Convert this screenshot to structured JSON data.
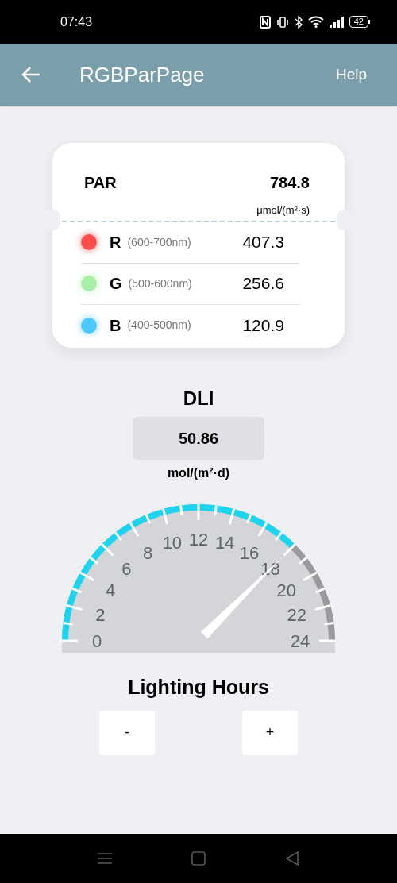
{
  "status_bar": {
    "time": "07:43",
    "battery": "42"
  },
  "app_bar": {
    "title": "RGBParPage",
    "action": "Help"
  },
  "par_card": {
    "label": "PAR",
    "value": "784.8",
    "unit": "μmol/(m²·s)",
    "channels": [
      {
        "letter": "R",
        "range": "(600-700nm)",
        "value": "407.3",
        "color": "#ff4d4d"
      },
      {
        "letter": "G",
        "range": "(500-600nm)",
        "value": "256.6",
        "color": "#a8f0a8"
      },
      {
        "letter": "B",
        "range": "(400-500nm)",
        "value": "120.9",
        "color": "#4cc9ff"
      }
    ]
  },
  "dli": {
    "title": "DLI",
    "value": "50.86",
    "unit": "mol/(m²·d)"
  },
  "gauge": {
    "labels": [
      "0",
      "2",
      "4",
      "6",
      "8",
      "10",
      "12",
      "14",
      "16",
      "18",
      "20",
      "22",
      "24"
    ]
  },
  "lighting_hours": {
    "title": "Lighting Hours",
    "buttons": [
      "-",
      "+"
    ]
  }
}
